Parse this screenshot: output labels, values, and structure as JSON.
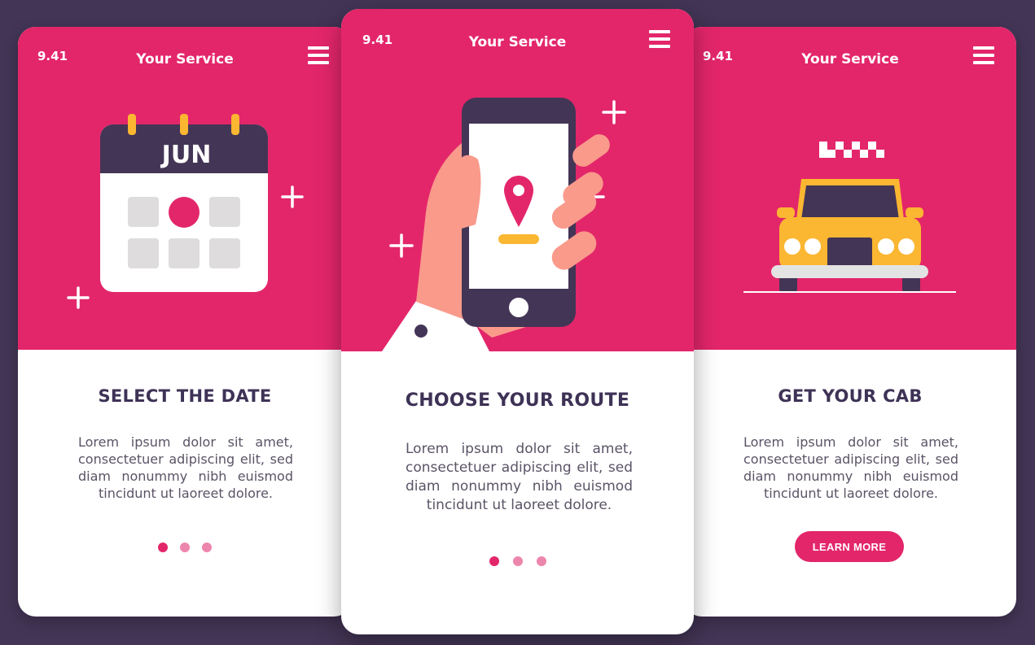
{
  "colors": {
    "background": "#433556",
    "accent": "#e3266a",
    "dot_inactive": "#ed86ac",
    "heading": "#3e3256",
    "yellow": "#fbb632"
  },
  "screens": [
    {
      "time": "9.41",
      "app_title": "Your Service",
      "menu_icon": "hamburger-menu-icon",
      "illustration": {
        "icon": "calendar-icon",
        "month": "JUN"
      },
      "heading": "SELECT THE DATE",
      "body": "Lorem ipsum dolor sit amet, consectetuer adipiscing elit, sed diam nonummy nibh euismod tincidunt ut laoreet dolore.",
      "pagination": {
        "total": 3,
        "active_index": 0
      }
    },
    {
      "time": "9.41",
      "app_title": "Your Service",
      "menu_icon": "hamburger-menu-icon",
      "illustration": {
        "icon": "hand-holding-phone-location-icon"
      },
      "heading": "CHOOSE YOUR ROUTE",
      "body": "Lorem ipsum dolor sit amet, consectetuer adipiscing elit, sed diam nonummy nibh euismod tincidunt ut laoreet dolore.",
      "pagination": {
        "total": 3,
        "active_index": 0
      }
    },
    {
      "time": "9.41",
      "app_title": "Your Service",
      "menu_icon": "hamburger-menu-icon",
      "illustration": {
        "icon": "taxi-car-icon"
      },
      "heading": "GET YOUR CAB",
      "body": "Lorem ipsum dolor sit amet, consectetuer adipiscing elit, sed diam nonummy nibh euismod tincidunt ut laoreet dolore.",
      "button_label": "LEARN MORE"
    }
  ]
}
